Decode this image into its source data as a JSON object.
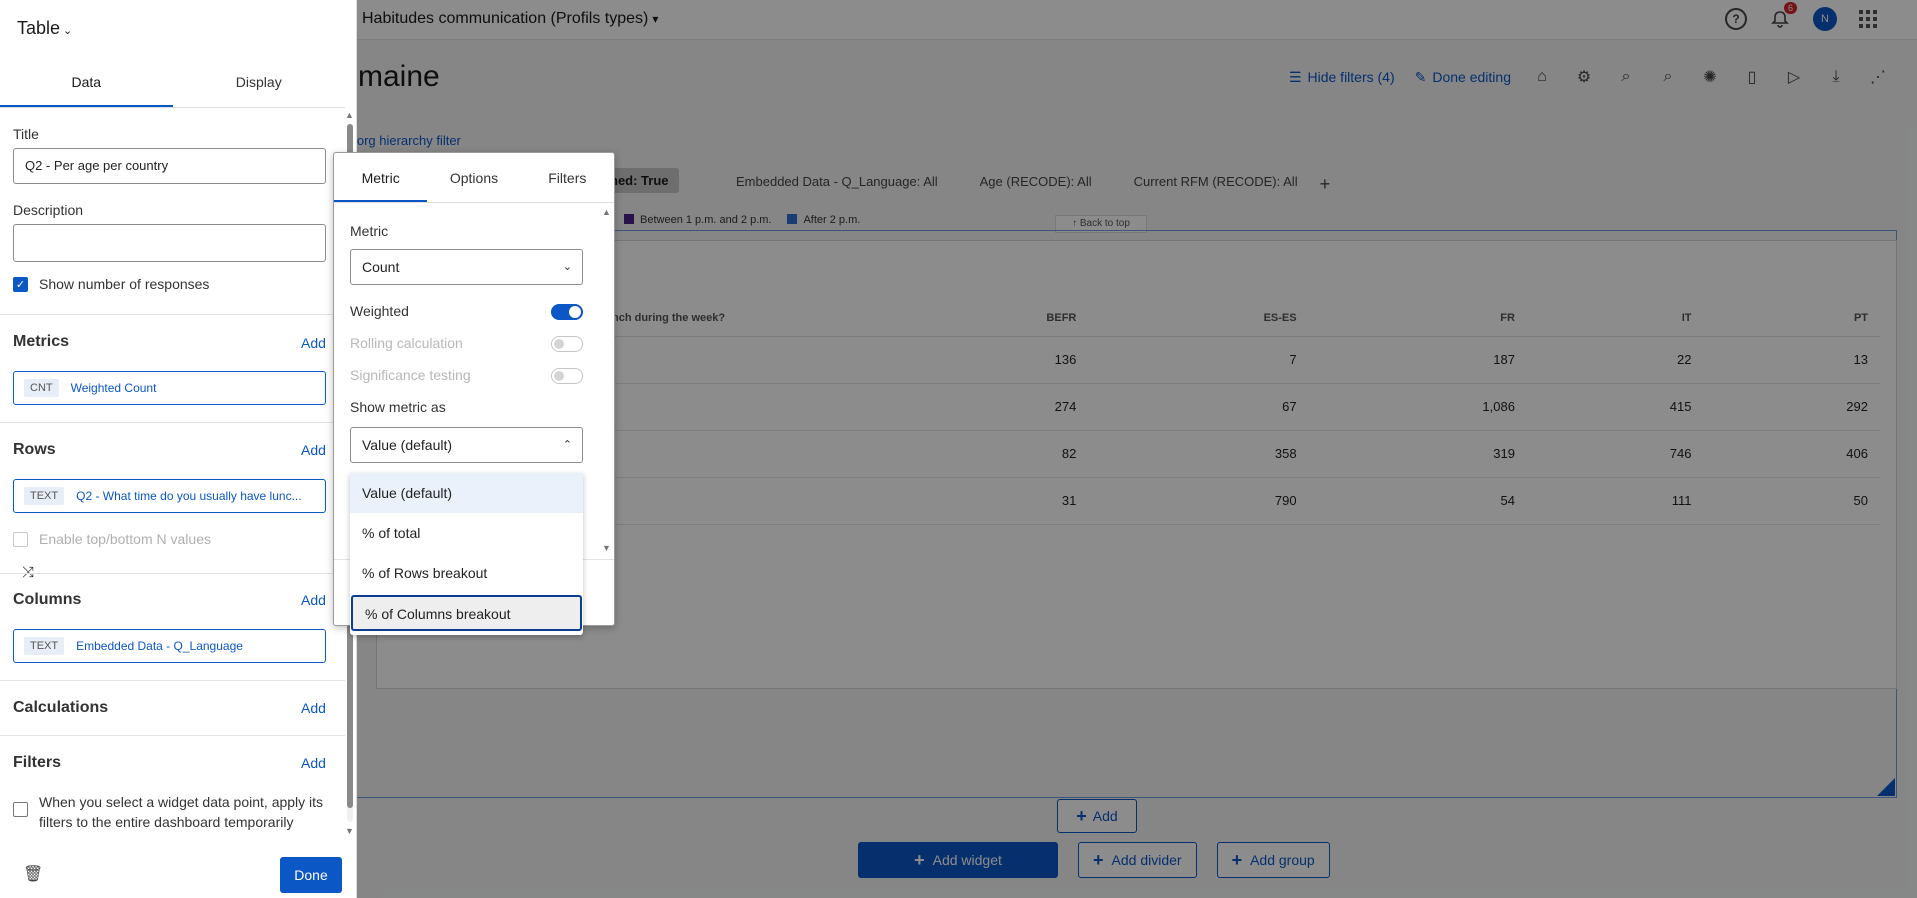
{
  "dashboard": {
    "project_title": "Habitudes communication (Profils types)",
    "page_title": "maine",
    "notification_count": "6",
    "user_initial": "N",
    "toolbar": {
      "hide_filters": "Hide filters (4)",
      "done_editing": "Done editing"
    },
    "org_link": "n org hierarchy filter",
    "filter_chip_dark": "hed: True",
    "filters": [
      "Embedded Data - Q_Language: All",
      "Age (RECODE): All",
      "Current RFM (RECODE): All"
    ],
    "legend": [
      {
        "label": "Between 1 p.m. and 2 p.m.",
        "color": "#4b1f8c"
      },
      {
        "label": "After 2 p.m.",
        "color": "#2f6fd0"
      }
    ],
    "back_to_top": "↑ Back to top",
    "table": {
      "question_header": "nch during the week?",
      "columns": [
        "BEFR",
        "ES-ES",
        "FR",
        "IT",
        "PT"
      ],
      "rows": [
        [
          "136",
          "7",
          "187",
          "22",
          "13"
        ],
        [
          "274",
          "67",
          "1,086",
          "415",
          "292"
        ],
        [
          "82",
          "358",
          "319",
          "746",
          "406"
        ],
        [
          "31",
          "790",
          "54",
          "111",
          "50"
        ]
      ]
    },
    "add_label": "Add",
    "add_widget": "Add widget",
    "add_divider": "Add divider",
    "add_group": "Add group"
  },
  "panel": {
    "widget_type": "Table",
    "tabs": [
      "Data",
      "Display"
    ],
    "title_label": "Title",
    "title_value": "Q2 - Per age per country",
    "description_label": "Description",
    "description_value": "",
    "show_responses": "Show number of responses",
    "metrics_title": "Metrics",
    "metric_tag": "CNT",
    "metric_name": "Weighted Count",
    "rows_title": "Rows",
    "row_tag": "TEXT",
    "row_name": "Q2 - What time do you usually have lunc...",
    "top_bottom": "Enable top/bottom N values",
    "columns_title": "Columns",
    "column_tag": "TEXT",
    "column_name": "Embedded Data - Q_Language",
    "calculations_title": "Calculations",
    "filters_title": "Filters",
    "add_label": "Add",
    "filters_apply": "When you select a widget data point, apply its filters to the entire dashboard temporarily",
    "done": "Done"
  },
  "popover": {
    "tabs": [
      "Metric",
      "Options",
      "Filters"
    ],
    "metric_label": "Metric",
    "metric_value": "Count",
    "weighted": "Weighted",
    "rolling": "Rolling calculation",
    "significance": "Significance testing",
    "show_as_label": "Show metric as",
    "show_as_value": "Value (default)",
    "options": [
      "Value (default)",
      "% of total",
      "% of Rows breakout",
      "% of Columns breakout"
    ]
  }
}
